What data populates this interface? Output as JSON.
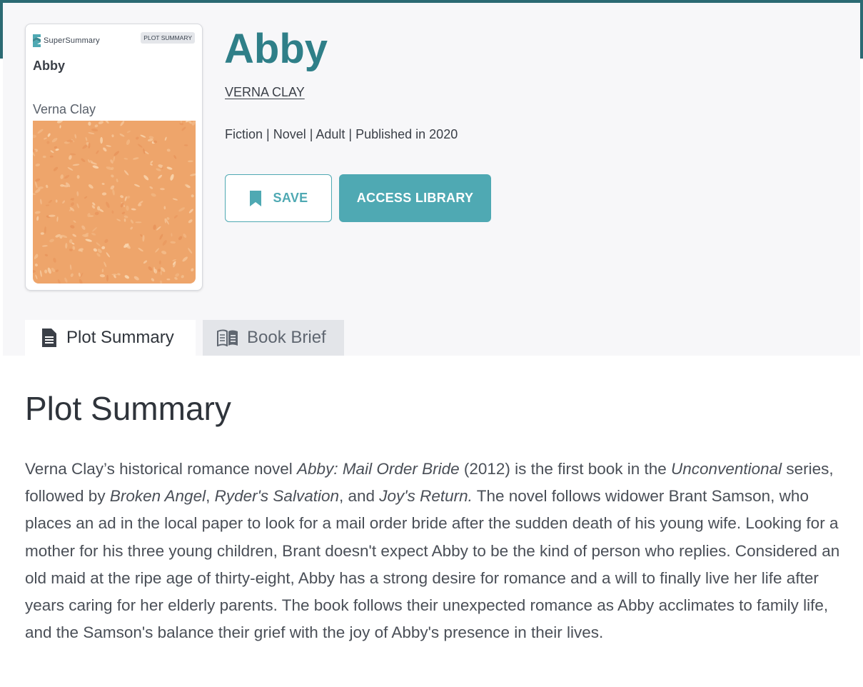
{
  "cover": {
    "brand": "SuperSummary",
    "badge": "PLOT SUMMARY",
    "title": "Abby",
    "author": "Verna Clay"
  },
  "book": {
    "title": "Abby",
    "author": "VERNA CLAY",
    "meta": "Fiction | Novel | Adult | Published in 2020"
  },
  "actions": {
    "save_label": "SAVE",
    "access_label": "ACCESS LIBRARY"
  },
  "tabs": [
    {
      "label": "Plot Summary",
      "active": true,
      "icon": "document-icon"
    },
    {
      "label": "Book Brief",
      "active": false,
      "icon": "open-book-icon"
    }
  ],
  "section": {
    "heading": "Plot Summary",
    "p1": "Verna Clay’s historical romance novel ",
    "i1": "Abby: Mail Order Bride",
    "p2": " (2012) is the first book in the ",
    "i2": "Unconventional",
    "p3": " series, followed by ",
    "i3": "Broken Angel",
    "p4": ", ",
    "i4": "Ryder's Salvation",
    "p5": ", and ",
    "i5": "Joy's Return.",
    "p6": " The novel follows widower Brant Samson, who places an ad in the local paper to look for a mail order bride after the sudden death of his young wife. Looking for a mother for his three young children, Brant doesn't expect Abby to be the kind of person who replies. Considered an old maid at the ripe age of thirty-eight, Abby has a strong desire for romance and a will to finally live her life after years caring for her elderly parents. The book follows their unexpected romance as Abby acclimates to family life, and the Samson's balance their grief with the joy of Abby's presence in their lives."
  },
  "colors": {
    "accent": "#4fa9b3",
    "title": "#2f7f88",
    "border_top": "#2b6a73",
    "cover_art": "#eea56b"
  }
}
